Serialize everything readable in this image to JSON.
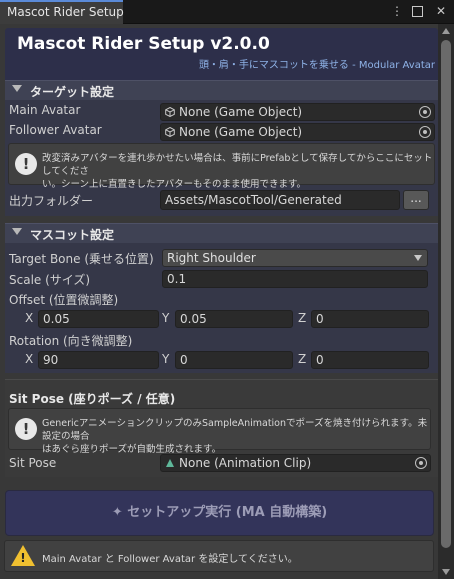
{
  "window": {
    "tab_title": "Mascot Rider Setup"
  },
  "header": {
    "title": "Mascot Rider Setup  v2.0.0",
    "subtitle": "頭・肩・手にマスコットを乗せる - Modular Avatar"
  },
  "target_section": {
    "title": "ターゲット設定",
    "main_avatar_label": "Main Avatar",
    "main_avatar_value": "None (Game Object)",
    "follower_avatar_label": "Follower Avatar",
    "follower_avatar_value": "None (Game Object)",
    "help_line1": "改変済みアバターを連れ歩かせたい場合は、事前にPrefabとして保存してからここにセットしてくださ",
    "help_line2": "い。シーン上に直置きしたアバターもそのまま使用できます。",
    "output_label": "出力フォルダー",
    "output_value": "Assets/MascotTool/Generated",
    "browse_label": "..."
  },
  "mascot_section": {
    "title": "マスコット設定",
    "target_bone_label": "Target Bone (乗せる位置)",
    "target_bone_value": "Right Shoulder",
    "scale_label": "Scale (サイズ)",
    "scale_value": "0.1",
    "offset_label": "Offset (位置微調整)",
    "offset": {
      "x": "0.05",
      "y": "0.05",
      "z": "0"
    },
    "rotation_label": "Rotation (向き微調整)",
    "rotation": {
      "x": "90",
      "y": "0",
      "z": "0"
    },
    "axis_x": "X",
    "axis_y": "Y",
    "axis_z": "Z"
  },
  "sitpose_section": {
    "title": "Sit Pose (座りポーズ / 任意)",
    "help_line1": "GenericアニメーションクリップのみSampleAnimationでポーズを焼き付けられます。未設定の場合",
    "help_line2": "はあぐら座りポーズが自動生成されます。",
    "sit_pose_label": "Sit Pose",
    "sit_pose_value": "None (Animation Clip)"
  },
  "run_button": {
    "label": "✦ セットアップ実行 (MA 自動構築)"
  },
  "warning": {
    "text": "Main Avatar と Follower Avatar を設定してください。"
  },
  "icons": {
    "menu": "kebab-menu-icon",
    "maximize": "maximize-icon",
    "close": "close-icon",
    "object_picker": "object-picker-icon",
    "info": "info-icon",
    "warning": "warning-icon"
  },
  "colors": {
    "header_bg": "#2d2f4a",
    "accent_text": "#8fb3e8",
    "run_button_bg": "#33345a",
    "warning_yellow": "#f0c030"
  }
}
